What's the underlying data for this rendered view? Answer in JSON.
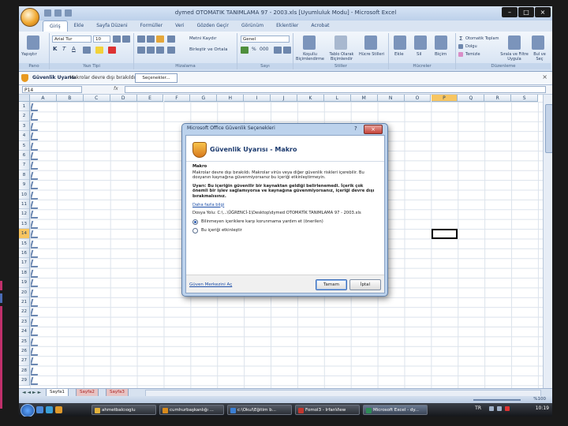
{
  "window": {
    "title": "dymed OTOMATIK TANIMLAMA 97 - 2003.xls [Uyumluluk Modu] - Microsoft Excel",
    "min_label": "–",
    "max_label": "□",
    "close_label": "×"
  },
  "ribbon": {
    "tabs": [
      "Giriş",
      "Ekle",
      "Sayfa Düzeni",
      "Formüller",
      "Veri",
      "Gözden Geçir",
      "Görünüm",
      "Eklentiler",
      "Acrobat"
    ],
    "active_tab": "Giriş",
    "clipboard": {
      "paste": "Yapıştır",
      "label": "Pano"
    },
    "font": {
      "name": "Arial Tur",
      "size": "10",
      "label": "Yazı Tipi"
    },
    "alignment": {
      "wrap": "Metni Kaydır",
      "merge": "Birleştir ve Ortala",
      "label": "Hizalama"
    },
    "number": {
      "format": "Genel",
      "label": "Sayı"
    },
    "styles": {
      "conditional": "Koşullu Biçimlendirme",
      "table": "Tablo Olarak Biçimlendir",
      "cell": "Hücre Stilleri",
      "label": "Stiller"
    },
    "cells": {
      "insert": "Ekle",
      "delete": "Sil",
      "format": "Biçim",
      "label": "Hücreler"
    },
    "editing": {
      "autosum": "Otomatik Toplam",
      "fill": "Dolgu",
      "clear": "Temizle",
      "sort": "Sırala ve Filtre Uygula",
      "find": "Bul ve Seç",
      "label": "Düzenleme"
    }
  },
  "security_bar": {
    "title": "Güvenlik Uyarısı",
    "message": "Makrolar devre dışı bırakıldı.",
    "button": "Seçenekler..."
  },
  "formula_bar": {
    "name_box": "P14",
    "fx": "fx",
    "value": ""
  },
  "grid": {
    "columns": [
      "A",
      "B",
      "C",
      "D",
      "E",
      "F",
      "G",
      "H",
      "I",
      "J",
      "K",
      "L",
      "M",
      "N",
      "O",
      "P",
      "Q",
      "R",
      "S"
    ],
    "rows": [
      "1",
      "2",
      "3",
      "4",
      "5",
      "6",
      "7",
      "8",
      "9",
      "10",
      "11",
      "12",
      "13",
      "14",
      "15",
      "16",
      "17",
      "18",
      "19",
      "20",
      "21",
      "22",
      "23",
      "24",
      "25",
      "26",
      "27",
      "28",
      "29"
    ],
    "selected_column": "P",
    "selected_row": "14"
  },
  "sheets": {
    "tabs": [
      "Sayfa1",
      "Sayfa2",
      "Sayfa3"
    ]
  },
  "status": {
    "zoom": "%100"
  },
  "dialog": {
    "window_title": "Microsoft Office Güvenlik Seçenekleri",
    "help": "?",
    "close": "×",
    "heading": "Güvenlik Uyarısı - Makro",
    "section": "Makro",
    "description": "Makrolar devre dışı bırakıldı. Makrolar virüs veya diğer güvenlik riskleri içerebilir. Bu dosyanın kaynağına güvenmiyorsanız bu içeriği etkinleştirmeyin.",
    "warning": "Uyarı: Bu içeriğin güvenilir bir kaynaktan geldiği belirlenemedi. İçerik çok önemli bir işlev sağlamıyorsa ve kaynağına güvenmiyorsanız, içeriği devre dışı bırakmalısınız.",
    "more_info": "Daha fazla bilgi",
    "file_path": "Dosya Yolu: C:\\...\\ÜĞRENCİ-1\\Desktop\\dymed OTOMATİK TANIMLAMA 97 - 2003.xls",
    "option1": "Bilinmeyen içeriklere karşı korunmama yardım et (önerilen)",
    "option2": "Bu içeriği etkinleştir",
    "trust_center": "Güven Merkezini Aç",
    "ok": "Tamam",
    "cancel": "İptal"
  },
  "taskbar": {
    "buttons": [
      "ahmetbalcıoglu",
      "cumhurbaşkanlığı ...",
      "c:\\Okul\\Eğitim b...",
      "Fomol3 - IrfanView",
      "Microsoft Excel - dy..."
    ],
    "active": "Microsoft Excel - dy...",
    "language": "TR",
    "clock": "10:19"
  }
}
